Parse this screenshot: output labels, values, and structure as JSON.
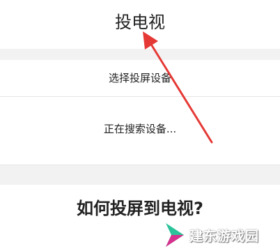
{
  "header": {
    "title": "投电视"
  },
  "options": {
    "select_device": "选择投屏设备",
    "searching": "正在搜索设备..."
  },
  "article": {
    "question": "如何投屏到电视?"
  },
  "watermark": {
    "text": "建东游戏园",
    "icon": "watermark-logo-icon"
  },
  "annotation": {
    "arrow_color": "#e53935"
  },
  "colors": {
    "background": "#ffffff",
    "separator_band": "#f2f2f2",
    "divider": "#e5e5e5",
    "text": "#222222",
    "watermark_green": "#2bc39a",
    "watermark_magenta": "#d6318e"
  }
}
